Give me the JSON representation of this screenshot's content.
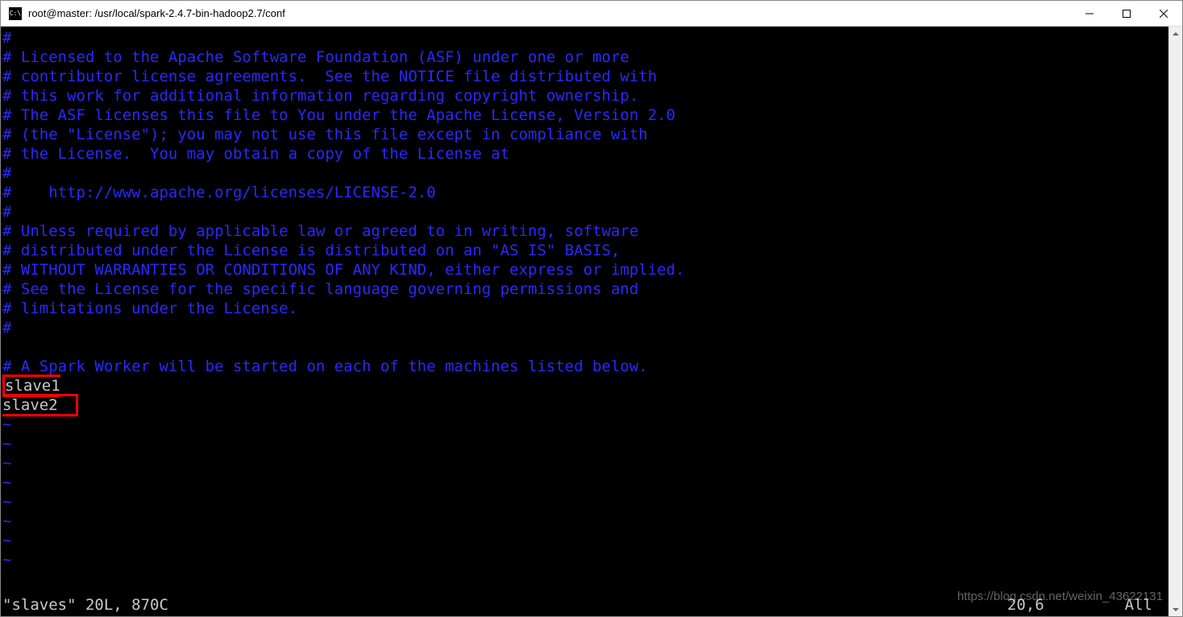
{
  "window": {
    "icon_text": "C:\\",
    "title": "root@master: /usr/local/spark-2.4.7-bin-hadoop2.7/conf"
  },
  "comments": [
    "#",
    "# Licensed to the Apache Software Foundation (ASF) under one or more",
    "# contributor license agreements.  See the NOTICE file distributed with",
    "# this work for additional information regarding copyright ownership.",
    "# The ASF licenses this file to You under the Apache License, Version 2.0",
    "# (the \"License\"); you may not use this file except in compliance with",
    "# the License.  You may obtain a copy of the License at",
    "#",
    "#    http://www.apache.org/licenses/LICENSE-2.0",
    "#",
    "# Unless required by applicable law or agreed to in writing, software",
    "# distributed under the License is distributed on an \"AS IS\" BASIS,",
    "# WITHOUT WARRANTIES OR CONDITIONS OF ANY KIND, either express or implied.",
    "# See the License for the specific language governing permissions and",
    "# limitations under the License.",
    "#",
    "",
    "# A Spark Worker will be started on each of the machines listed below."
  ],
  "entries": {
    "slave1": "slave1",
    "slave2": "slave2"
  },
  "tildes": [
    "~",
    "~",
    "~",
    "~",
    "~",
    "~",
    "~",
    "~"
  ],
  "status": {
    "file": "\"slaves\" 20L, 870C",
    "position": "20,6",
    "scroll": "All"
  },
  "watermark": "https://blog.csdn.net/weixin_43622131"
}
